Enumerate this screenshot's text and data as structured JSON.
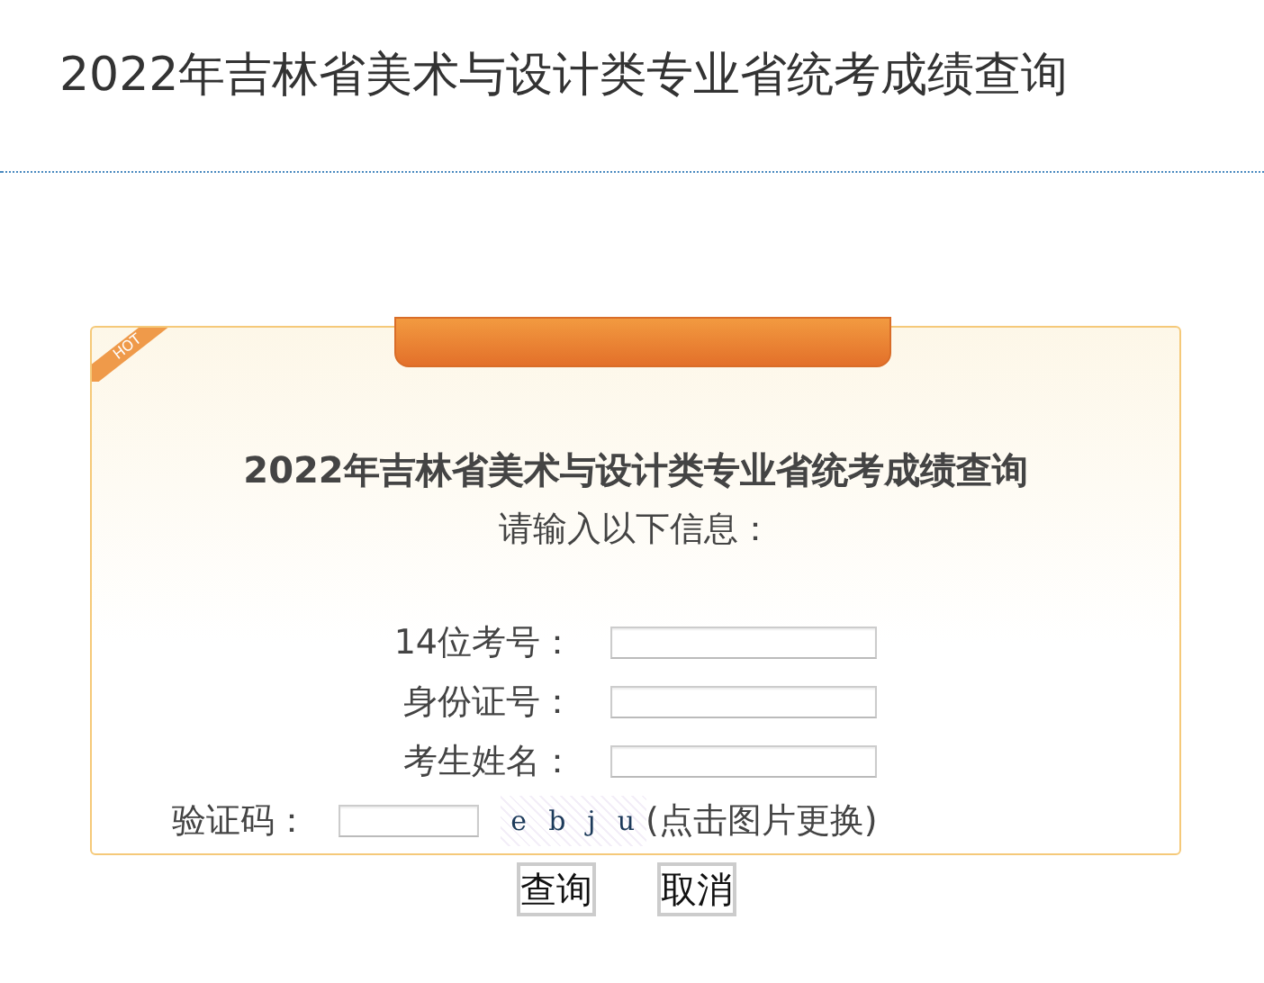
{
  "page_title": "2022年吉林省美术与设计类专业省统考成绩查询",
  "card": {
    "badge": "HOT",
    "title": "2022年吉林省美术与设计类专业省统考成绩查询",
    "subtitle": "请输入以下信息：",
    "fields": [
      {
        "label": "14位考号："
      },
      {
        "label": "身份证号："
      },
      {
        "label": "考生姓名："
      }
    ],
    "captcha": {
      "label": "验证码：",
      "chars": [
        "e",
        "b",
        "j",
        "u"
      ],
      "hint": "(点击图片更换)"
    },
    "buttons": [
      "查询",
      "取消"
    ]
  }
}
